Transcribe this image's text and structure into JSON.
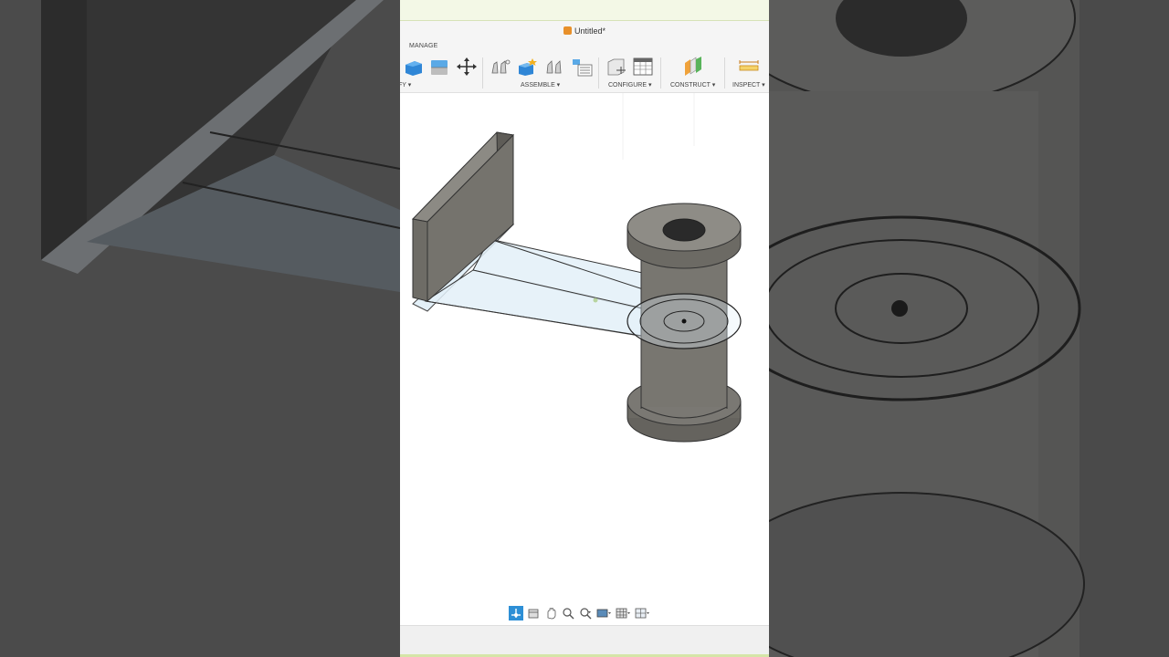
{
  "window": {
    "title": "Untitled*"
  },
  "toolbar": {
    "active_tab": "MANAGE",
    "groups": [
      {
        "label": "FY ▾"
      },
      {
        "label": "ASSEMBLE ▾"
      },
      {
        "label": "CONFIGURE ▾"
      },
      {
        "label": "CONSTRUCT ▾"
      },
      {
        "label": "INSPECT ▾"
      }
    ]
  },
  "icons": {
    "modify_1": "blue-box-icon",
    "modify_2": "press-pull-icon",
    "modify_3": "move-icon",
    "assemble_1": "joint-icon",
    "assemble_2": "new-component-icon",
    "assemble_3": "as-built-joint-icon",
    "assemble_4": "bill-of-materials-icon",
    "configure_1": "parameter-icon",
    "configure_2": "configuration-table-icon",
    "construct_1": "plane-icon",
    "inspect_1": "measure-icon"
  },
  "navigation_bar": {
    "items": [
      "orbit",
      "look-at",
      "pan",
      "zoom",
      "fit",
      "display-settings",
      "grid",
      "viewports"
    ]
  },
  "colors": {
    "accent": "#2d8fd6",
    "body_fill": "#75736d",
    "sketch_fill": "#e3f0f8",
    "top_strip": "#f3f8e6"
  }
}
